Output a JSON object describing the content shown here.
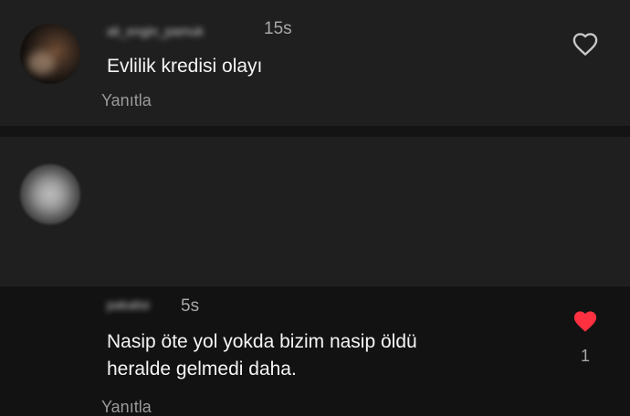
{
  "comments": [
    {
      "username": "ali_engin_pamuk",
      "time": "15s",
      "text": "Evlilik kredisi olayı",
      "reply_label": "Yanıtla",
      "liked": false,
      "heart_icon": "heart-outline-icon"
    },
    {
      "username": "pakalisi",
      "time": "5s",
      "text_line1": "Nasip öte yol yokda bizim nasip öldü",
      "text_line2": "heralde gelmedi daha.",
      "reply_label": "Yanıtla",
      "liked": true,
      "like_count": "1",
      "heart_icon": "heart-filled-icon",
      "heart_color": "#ff3040"
    }
  ]
}
